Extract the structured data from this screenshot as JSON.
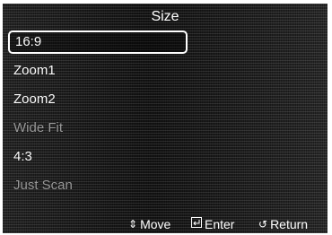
{
  "title": "Size",
  "menu": {
    "items": [
      {
        "label": "16:9",
        "state": "selected"
      },
      {
        "label": "Zoom1",
        "state": "enabled"
      },
      {
        "label": "Zoom2",
        "state": "enabled"
      },
      {
        "label": "Wide Fit",
        "state": "disabled"
      },
      {
        "label": "4:3",
        "state": "enabled"
      },
      {
        "label": "Just Scan",
        "state": "disabled"
      }
    ]
  },
  "footer": {
    "move_label": "Move",
    "enter_label": "Enter",
    "return_label": "Return",
    "move_icon": "up-down-arrows-icon",
    "enter_icon": "enter-icon",
    "return_icon": "return-arrow-icon"
  }
}
